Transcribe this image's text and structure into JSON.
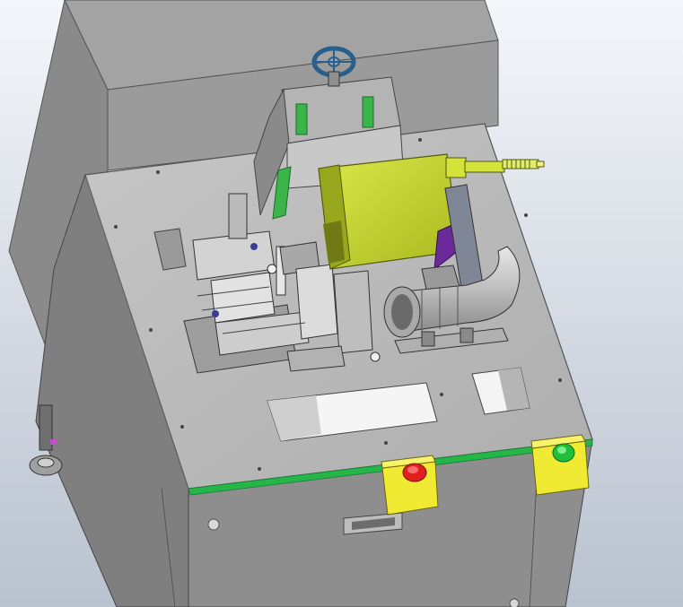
{
  "viewport": {
    "background_top": "#f4f6fa",
    "background_bottom": "#b9c2cf"
  },
  "colors": {
    "cabinet_body": "#8d8d8d",
    "cabinet_back": "#9a9a9a",
    "table_top": "#b9b9b9",
    "table_edge": "#7a7a7a",
    "green_trim": "#25b64a",
    "motor_yellow_green": "#c6d62a",
    "motor_shade": "#98a81c",
    "stop_button_red": "#e0201f",
    "start_button_green": "#1fbf3a",
    "button_housing_yellow": "#f0ea33",
    "handwheel_blue": "#2a5e8c",
    "bracket_purple": "#6a2a9a",
    "rail_green": "#39b54a",
    "pipe_gray": "#c9c9c9"
  },
  "components": [
    {
      "id": "machine-cabinet",
      "icon": "cabinet"
    },
    {
      "id": "rear-enclosure",
      "icon": "enclosure"
    },
    {
      "id": "table-top-plate",
      "icon": "plate"
    },
    {
      "id": "handwheel",
      "icon": "handwheel-icon"
    },
    {
      "id": "motor-assembly",
      "icon": "motor-icon"
    },
    {
      "id": "exhaust-pipe",
      "icon": "pipe-icon"
    },
    {
      "id": "stop-button",
      "icon": "emergency-stop-icon"
    },
    {
      "id": "start-button",
      "icon": "start-button-icon"
    },
    {
      "id": "leveling-foot",
      "icon": "foot-icon"
    }
  ]
}
